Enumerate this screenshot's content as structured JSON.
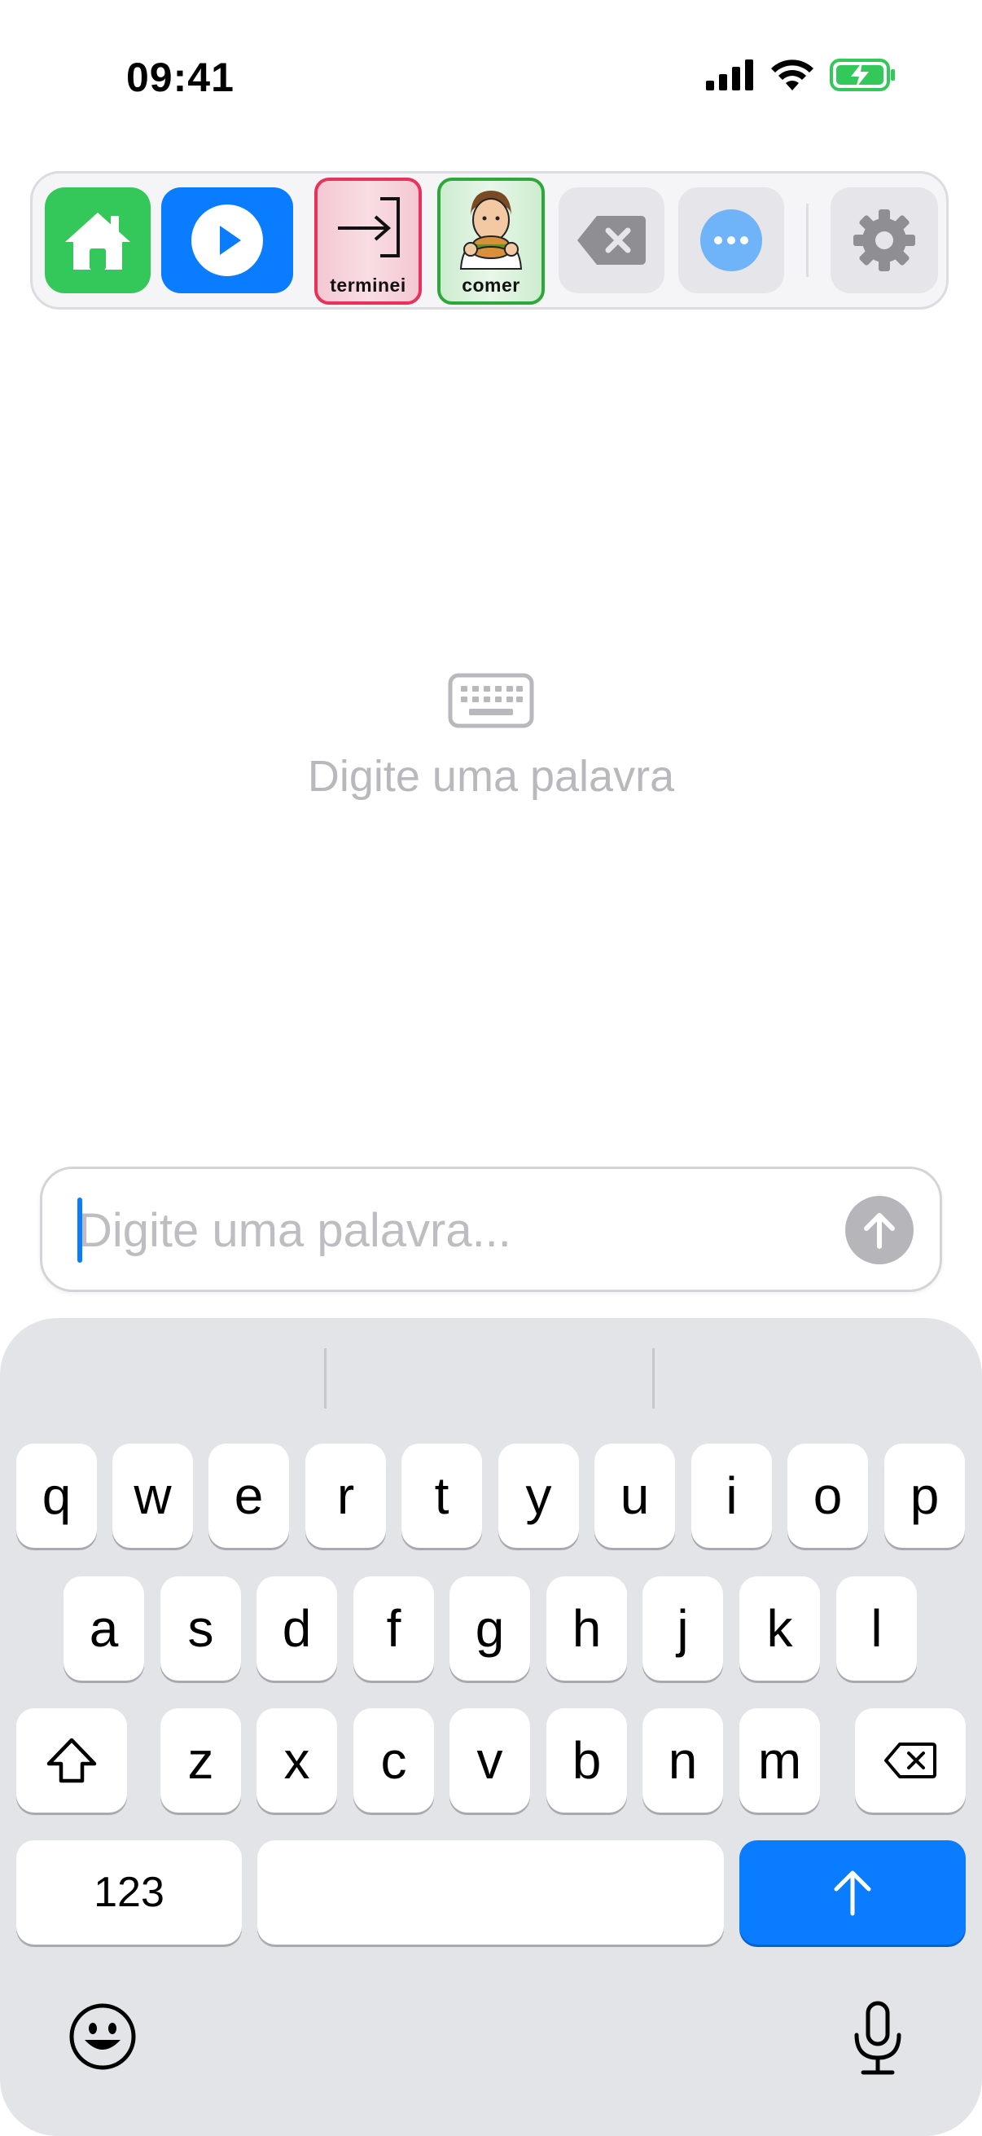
{
  "status_bar": {
    "time": "09:41"
  },
  "toolbar": {
    "home_icon": "house-icon",
    "play_icon": "play-icon",
    "cards": [
      {
        "label": "terminei",
        "icon": "arrow-into-bracket-pictogram",
        "border_color": "#e8315b"
      },
      {
        "label": "comer",
        "icon": "person-eating-pictogram",
        "border_color": "#2ea83c"
      }
    ],
    "delete_icon": "backspace-icon",
    "more_icon": "ellipsis-icon",
    "settings_icon": "gear-icon"
  },
  "empty_state": {
    "icon": "keyboard-icon",
    "text": "Digite uma palavra"
  },
  "input": {
    "placeholder": "Digite uma palavra...",
    "value": ""
  },
  "keyboard": {
    "row1": [
      "q",
      "w",
      "e",
      "r",
      "t",
      "y",
      "u",
      "i",
      "o",
      "p"
    ],
    "row2": [
      "a",
      "s",
      "d",
      "f",
      "g",
      "h",
      "j",
      "k",
      "l"
    ],
    "row3": [
      "z",
      "x",
      "c",
      "v",
      "b",
      "n",
      "m"
    ],
    "numbers_label": "123",
    "shift_icon": "shift-icon",
    "backspace_icon": "backspace-icon",
    "return_icon": "arrow-up-icon",
    "emoji_icon": "emoji-icon",
    "mic_icon": "microphone-icon"
  },
  "colors": {
    "accent": "#0a7cff",
    "home_green": "#34c759"
  }
}
